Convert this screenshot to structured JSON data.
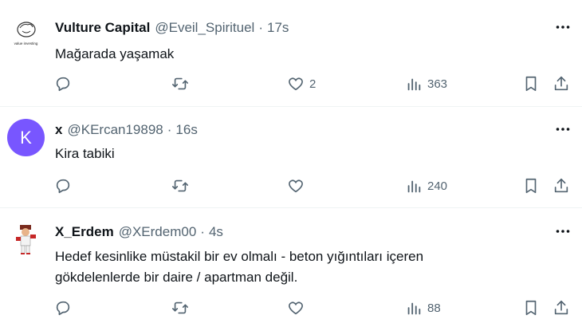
{
  "tweets": [
    {
      "name": "Vulture Capital",
      "handle": "@Eveil_Spirituel",
      "separator": "·",
      "time": "17s",
      "text": "Mağarada yaşamak",
      "avatar_caption": "value investing",
      "likes": "2",
      "views": "363"
    },
    {
      "name": "x",
      "handle": "@KErcan19898",
      "separator": "·",
      "time": "16s",
      "text": "Kira tabiki",
      "avatar_letter": "K",
      "likes": "",
      "views": "240"
    },
    {
      "name": "X_Erdem",
      "handle": "@XErdem00",
      "separator": "·",
      "time": "4s",
      "text_lines": [
        "Hedef kesinlike müstakil bir ev olmalı - beton yığıntıları içeren",
        "gökdelenlerde bir daire / apartman değil."
      ],
      "likes": "",
      "views": "88"
    }
  ],
  "icons": {
    "more": "more-horizontal-icon",
    "reply": "reply-icon",
    "retweet": "retweet-icon",
    "like": "heart-icon",
    "views": "views-chart-icon",
    "bookmark": "bookmark-icon",
    "share": "share-icon"
  },
  "colors": {
    "text_primary": "#0f1419",
    "text_secondary": "#536471",
    "avatar_k_bg": "#7856ff",
    "divider": "#eff3f4"
  }
}
